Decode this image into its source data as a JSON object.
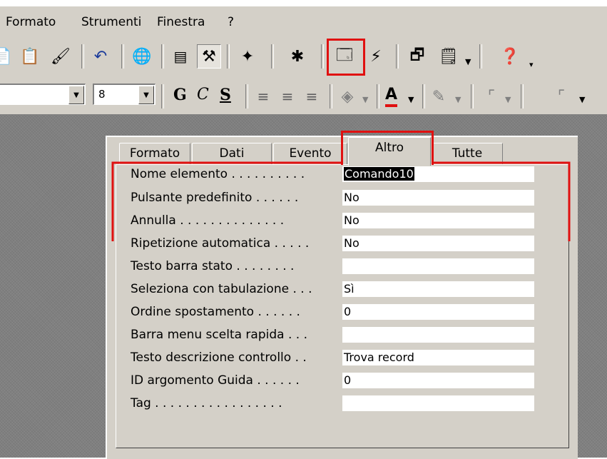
{
  "menubar": {
    "items": [
      "Formato",
      "Strumenti",
      "Finestra",
      "?"
    ]
  },
  "toolbar": {
    "font_size": "8",
    "bold_label": "G",
    "italic_label": "C",
    "underline_label": "S",
    "font_color_label": "A"
  },
  "tabs": {
    "items": [
      "Formato",
      "Dati",
      "Evento",
      "Altro",
      "Tutte"
    ],
    "active": "Altro"
  },
  "properties": [
    {
      "label": "Nome elemento . . . . . . . . . .",
      "value": "Comando10"
    },
    {
      "label": "Pulsante predefinito . . . . . .",
      "value": "No"
    },
    {
      "label": "Annulla . . . . . . . . . . . . . .",
      "value": "No"
    },
    {
      "label": "Ripetizione automatica . . . . .",
      "value": "No"
    },
    {
      "label": "Testo barra stato . . . . . . . .",
      "value": ""
    },
    {
      "label": "Seleziona con tabulazione . . .",
      "value": "Sì"
    },
    {
      "label": "Ordine spostamento . . . . . .",
      "value": "0"
    },
    {
      "label": "Barra menu scelta rapida . . .",
      "value": ""
    },
    {
      "label": "Testo descrizione controllo . .",
      "value": "Trova record"
    },
    {
      "label": "ID argomento Guida . . . . . .",
      "value": "0"
    },
    {
      "label": "Tag . . . . . . . . . . . . . . . . .",
      "value": ""
    }
  ],
  "colors": {
    "highlight": "#e01010",
    "chrome": "#d4d0c8"
  }
}
